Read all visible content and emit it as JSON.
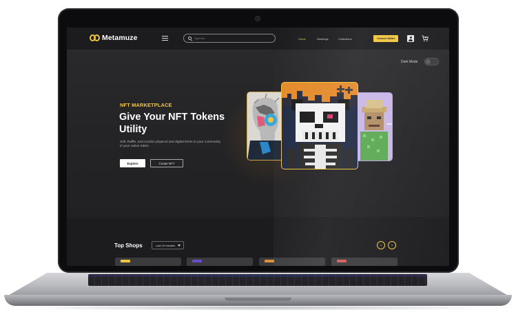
{
  "brand": {
    "name": "Metamuze"
  },
  "search": {
    "placeholder": "Type here"
  },
  "nav": {
    "links": [
      {
        "label": "Home",
        "active": true
      },
      {
        "label": "Rankings",
        "active": false
      },
      {
        "label": "Collections",
        "active": false
      }
    ],
    "connect_label": "Connect Wallet"
  },
  "dark_mode": {
    "label": "Dark Mode",
    "on": false
  },
  "hero": {
    "eyebrow": "NFT MARKETPLACE",
    "title": "Give Your NFT Tokens Utility",
    "description": "Sell, Raffle, and Auction physical and digital items to your community in your native token.",
    "explore_label": "Explore",
    "create_label": "Create NFT"
  },
  "shops": {
    "title": "Top Shops",
    "filter_value": "Last 15 minutes"
  },
  "colors": {
    "accent": "#f2c53d",
    "background": "#262628",
    "nav_bg": "#1c1c1e"
  },
  "icons": [
    "menu-icon",
    "search-icon",
    "user-icon",
    "cart-icon",
    "chevron-down-icon",
    "chevron-left-icon",
    "chevron-right-icon"
  ]
}
